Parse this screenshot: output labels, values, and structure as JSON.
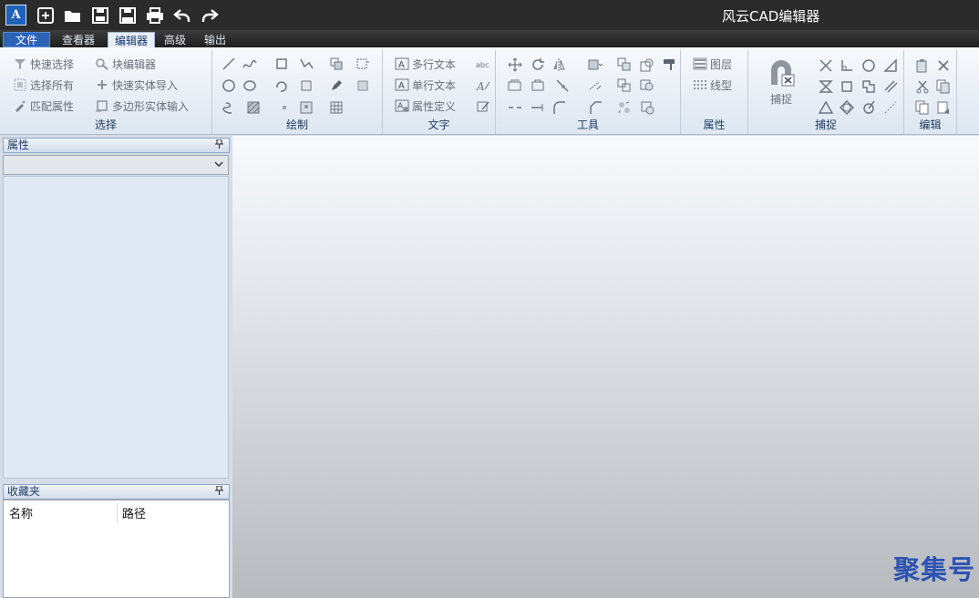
{
  "app": {
    "title": "风云CAD编辑器",
    "logo_icon": "app-logo-icon",
    "logo_text": "A"
  },
  "quick_access": [
    "new-icon",
    "open-icon",
    "save-icon",
    "save-as-pdf-icon",
    "print-icon",
    "undo-icon",
    "redo-icon"
  ],
  "tabs": {
    "file": "文件",
    "viewer": "查看器",
    "editor": "编辑器",
    "advanced": "高级",
    "output": "输出",
    "active": "编辑器"
  },
  "ribbon": {
    "select": {
      "label": "选择",
      "quick_select": "快速选择",
      "select_all": "选择所有",
      "match_props": "匹配属性",
      "block_editor": "块编辑器",
      "quick_entity_import": "快速实体导入",
      "polygon_entity_input": "多边形实体输入"
    },
    "draw": {
      "label": "绘制"
    },
    "text": {
      "label": "文字",
      "mtext": "多行文本",
      "stext": "单行文本",
      "attdef": "属性定义"
    },
    "tools": {
      "label": "工具"
    },
    "props": {
      "label": "属性",
      "layer": "图层",
      "linetype": "线型"
    },
    "snap": {
      "label": "捕捉",
      "snap_button": "捕捉"
    },
    "edit": {
      "label": "编辑"
    }
  },
  "panels": {
    "properties": {
      "title": "属性",
      "pin": "📌"
    },
    "favorites": {
      "title": "收藏夹",
      "col_name": "名称",
      "col_path": "路径"
    }
  },
  "watermark": "聚集号",
  "colors": {
    "titlebar": "#2b2b2b",
    "tab_file": "#2c63b9",
    "ribbon_label": "#1e3a5f",
    "watermark": "#2d53b3"
  }
}
